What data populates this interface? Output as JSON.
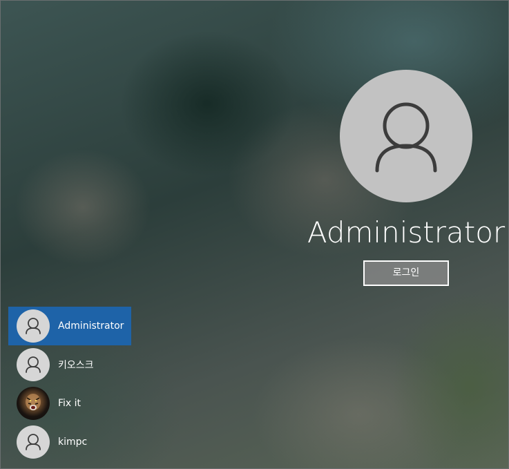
{
  "lock_screen": {
    "selected_user": {
      "name": "Administrator",
      "avatar_icon": "person-icon"
    },
    "login_button_label": "로그인",
    "colors": {
      "selection": "#1e63a8",
      "avatar_bg": "#c2c2c2",
      "icon_stroke": "#3c3c3c"
    }
  },
  "user_list": {
    "items": [
      {
        "label": "Administrator",
        "avatar": "person-icon",
        "selected": true
      },
      {
        "label": "키오스크",
        "avatar": "person-icon",
        "selected": false
      },
      {
        "label": "Fix it",
        "avatar": "tiger-photo",
        "selected": false
      },
      {
        "label": "kimpc",
        "avatar": "person-icon",
        "selected": false
      }
    ]
  }
}
